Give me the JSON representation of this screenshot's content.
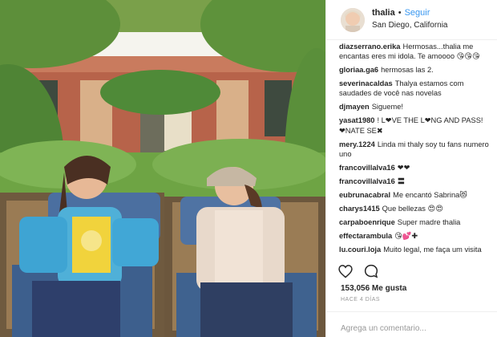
{
  "post": {
    "username": "thalia",
    "separator": "•",
    "follow_label": "Seguir",
    "location": "San Diego, California"
  },
  "comments": [
    {
      "user": "diazserrano.erika",
      "text": "Hermosas...thalia me encantas eres mi idola. Te amoooo 😘😘😘"
    },
    {
      "user": "gloriaa.ga6",
      "text": "hermosas las 2."
    },
    {
      "user": "severinacaldas",
      "text": "Thalya estamos com saudades de você nas novelas"
    },
    {
      "user": "djmayen",
      "text": "Sigueme!"
    },
    {
      "user": "yasat1980",
      "text": "! L❤VE THE L❤NG AND PASS! ❤NATE SE✖"
    },
    {
      "user": "mery.1224",
      "text": "Linda mi thaly soy tu fans numero uno"
    },
    {
      "user": "francovillalva16",
      "text": "❤❤"
    },
    {
      "user": "francovillalva16",
      "text": "〓"
    },
    {
      "user": "eubrunacabral",
      "text": "Me encantó Sabrina😻"
    },
    {
      "user": "charys1415",
      "text": "Que bellezas 😍😍"
    },
    {
      "user": "carpaboenrique",
      "text": "Super madre thalia"
    },
    {
      "user": "effectarambula",
      "text": "😘💕✚"
    },
    {
      "user": "lu.couri.loja",
      "text": "Muito legal, me faça um visita também 😊"
    }
  ],
  "actions": {
    "like_icon": "heart-icon",
    "comment_icon": "speech-bubble-icon"
  },
  "likes_text": "153,056 Me gusta",
  "time_text": "HACE 4 DÍAS",
  "comment_placeholder": "Agrega un comentario..."
}
